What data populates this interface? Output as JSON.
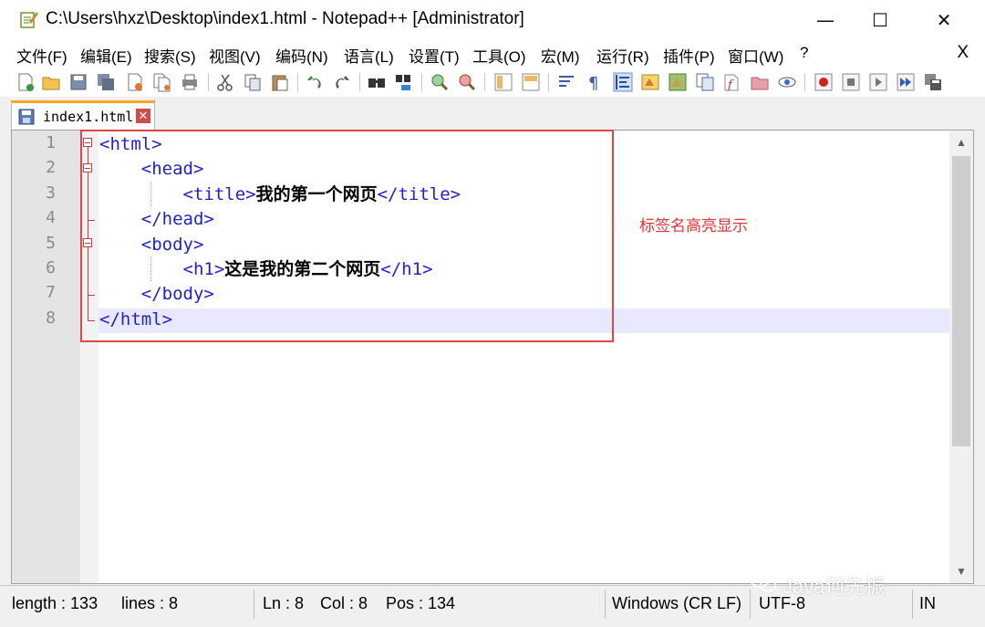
{
  "window": {
    "title": "C:\\Users\\hxz\\Desktop\\index1.html - Notepad++ [Administrator]",
    "minimize": "—",
    "maximize": "☐",
    "close": "✕"
  },
  "menubar": {
    "items": [
      "文件(F)",
      "编辑(E)",
      "搜索(S)",
      "视图(V)",
      "编码(N)",
      "语言(L)",
      "设置(T)",
      "工具(O)",
      "宏(M)",
      "运行(R)",
      "插件(P)",
      "窗口(W)",
      "?"
    ],
    "close": "X"
  },
  "tab": {
    "label": "index1.html",
    "close": "✕"
  },
  "editor": {
    "line_numbers": [
      "1",
      "2",
      "3",
      "4",
      "5",
      "6",
      "7",
      "8"
    ],
    "lines": [
      {
        "indent": "",
        "open": "<html>",
        "text": "",
        "close": ""
      },
      {
        "indent": "    ",
        "open": "<head>",
        "text": "",
        "close": ""
      },
      {
        "indent": "        ",
        "open": "<title>",
        "text": "我的第一个网页",
        "close": "</title>"
      },
      {
        "indent": "    ",
        "open": "</head>",
        "text": "",
        "close": ""
      },
      {
        "indent": "    ",
        "open": "<body>",
        "text": "",
        "close": ""
      },
      {
        "indent": "        ",
        "open": "<h1>",
        "text": "这是我的第二个网页",
        "close": "</h1>"
      },
      {
        "indent": "    ",
        "open": "</body>",
        "text": "",
        "close": ""
      },
      {
        "indent": "",
        "open": "</html>",
        "text": "",
        "close": ""
      }
    ],
    "annotation": "标签名高亮显示"
  },
  "statusbar": {
    "length": "length : 133",
    "lines": "lines : 8",
    "ln": "Ln : 8",
    "col": "Col : 8",
    "pos": "Pos : 134",
    "eol": "Windows (CR LF)",
    "encoding": "UTF-8",
    "mode": "IN"
  },
  "watermark": "Java何先振",
  "colors": {
    "tag": "#1f1fd6",
    "annotation": "#e53333",
    "current_line": "#e8e8ff"
  }
}
